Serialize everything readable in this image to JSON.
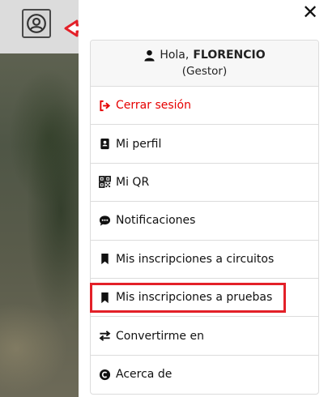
{
  "header": {
    "user_toggle_icon": "user-circle-icon",
    "close_label": "✕"
  },
  "menu": {
    "greeting_prefix": "Hola,",
    "user_name": "FLORENCIO",
    "role": "(Gestor)",
    "items": [
      {
        "label": "Cerrar sesión",
        "icon": "logout-icon",
        "color": "#e60000"
      },
      {
        "label": "Mi perfil",
        "icon": "id-card-icon"
      },
      {
        "label": "Mi QR",
        "icon": "qr-code-icon"
      },
      {
        "label": "Notificaciones",
        "icon": "comment-dots-icon"
      },
      {
        "label": "Mis inscripciones a circuitos",
        "icon": "bookmark-icon"
      },
      {
        "label": "Mis inscripciones a pruebas",
        "icon": "bookmark-icon"
      },
      {
        "label": "Convertirme en",
        "icon": "exchange-icon"
      },
      {
        "label": "Acerca de",
        "icon": "copyright-icon"
      }
    ]
  },
  "annotation": {
    "highlight_color": "#e32028"
  }
}
